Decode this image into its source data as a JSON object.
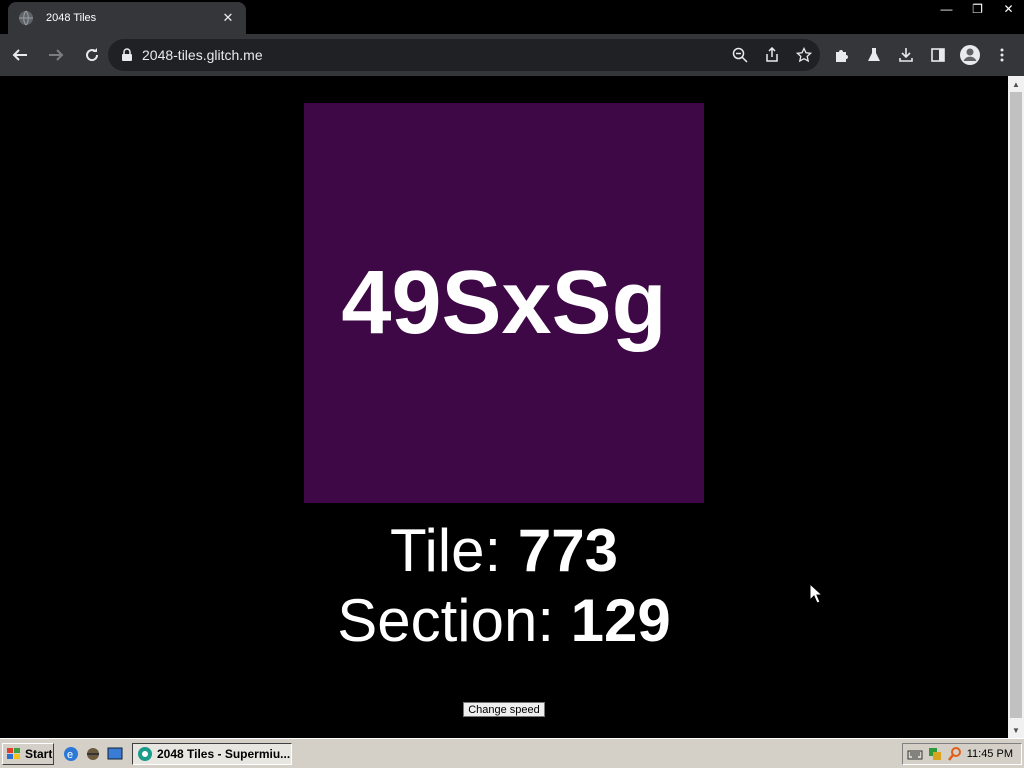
{
  "browser": {
    "tab_title": "2048 Tiles",
    "tab_close": "✕",
    "url": "2048-tiles.glitch.me",
    "window_controls": {
      "minimize": "—",
      "restore": "❐",
      "close": "✕"
    }
  },
  "page": {
    "tile_text": "49SxSg",
    "tile_color": "#3d0845",
    "tile_label": "Tile: ",
    "tile_value": "773",
    "section_label": "Section: ",
    "section_value": "129",
    "change_speed_label": "Change speed"
  },
  "taskbar": {
    "start_label": "Start",
    "task_label": "2048 Tiles - Supermiu...",
    "clock": "11:45 PM"
  }
}
